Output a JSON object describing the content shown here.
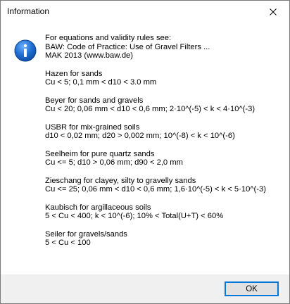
{
  "window": {
    "title": "Information"
  },
  "message": {
    "paragraphs": [
      {
        "lines": [
          "For equations and validity rules see:",
          "BAW: Code of Practice: Use of Gravel Filters ...",
          "MAK 2013 (www.baw.de)"
        ]
      },
      {
        "lines": [
          "Hazen for sands",
          "Cu < 5; 0,1 mm < d10 < 3.0 mm"
        ]
      },
      {
        "lines": [
          "Beyer for sands and gravels",
          "Cu < 20; 0,06 mm < d10 < 0,6 mm; 2·10^(-5) < k < 4·10^(-3)"
        ]
      },
      {
        "lines": [
          "USBR for mix-grained soils",
          "d10 < 0,02 mm; d20 > 0,002 mm; 10^(-8) < k < 10^(-6)"
        ]
      },
      {
        "lines": [
          "Seelheim for pure quartz sands",
          "Cu <= 5; d10 > 0,06 mm; d90 < 2,0 mm"
        ]
      },
      {
        "lines": [
          "Zieschang for clayey, silty to gravelly sands",
          "Cu <= 25; 0,06 mm < d10 < 0,6 mm; 1,6·10^(-5) < k < 5·10^(-3)"
        ]
      },
      {
        "lines": [
          "Kaubisch for argillaceous soils",
          "5 < Cu < 400; k < 10^(-6); 10% < Total(U+T) < 60%"
        ]
      },
      {
        "lines": [
          "Seiler for gravels/sands",
          "5 < Cu < 100"
        ]
      }
    ]
  },
  "buttons": {
    "ok_label": "OK"
  },
  "icons": {
    "info": "info-icon",
    "close": "close-icon"
  },
  "colors": {
    "info_icon_blue": "#1f6fd1",
    "button_border": "#0078d7",
    "footer_background": "#f0f0f0"
  }
}
